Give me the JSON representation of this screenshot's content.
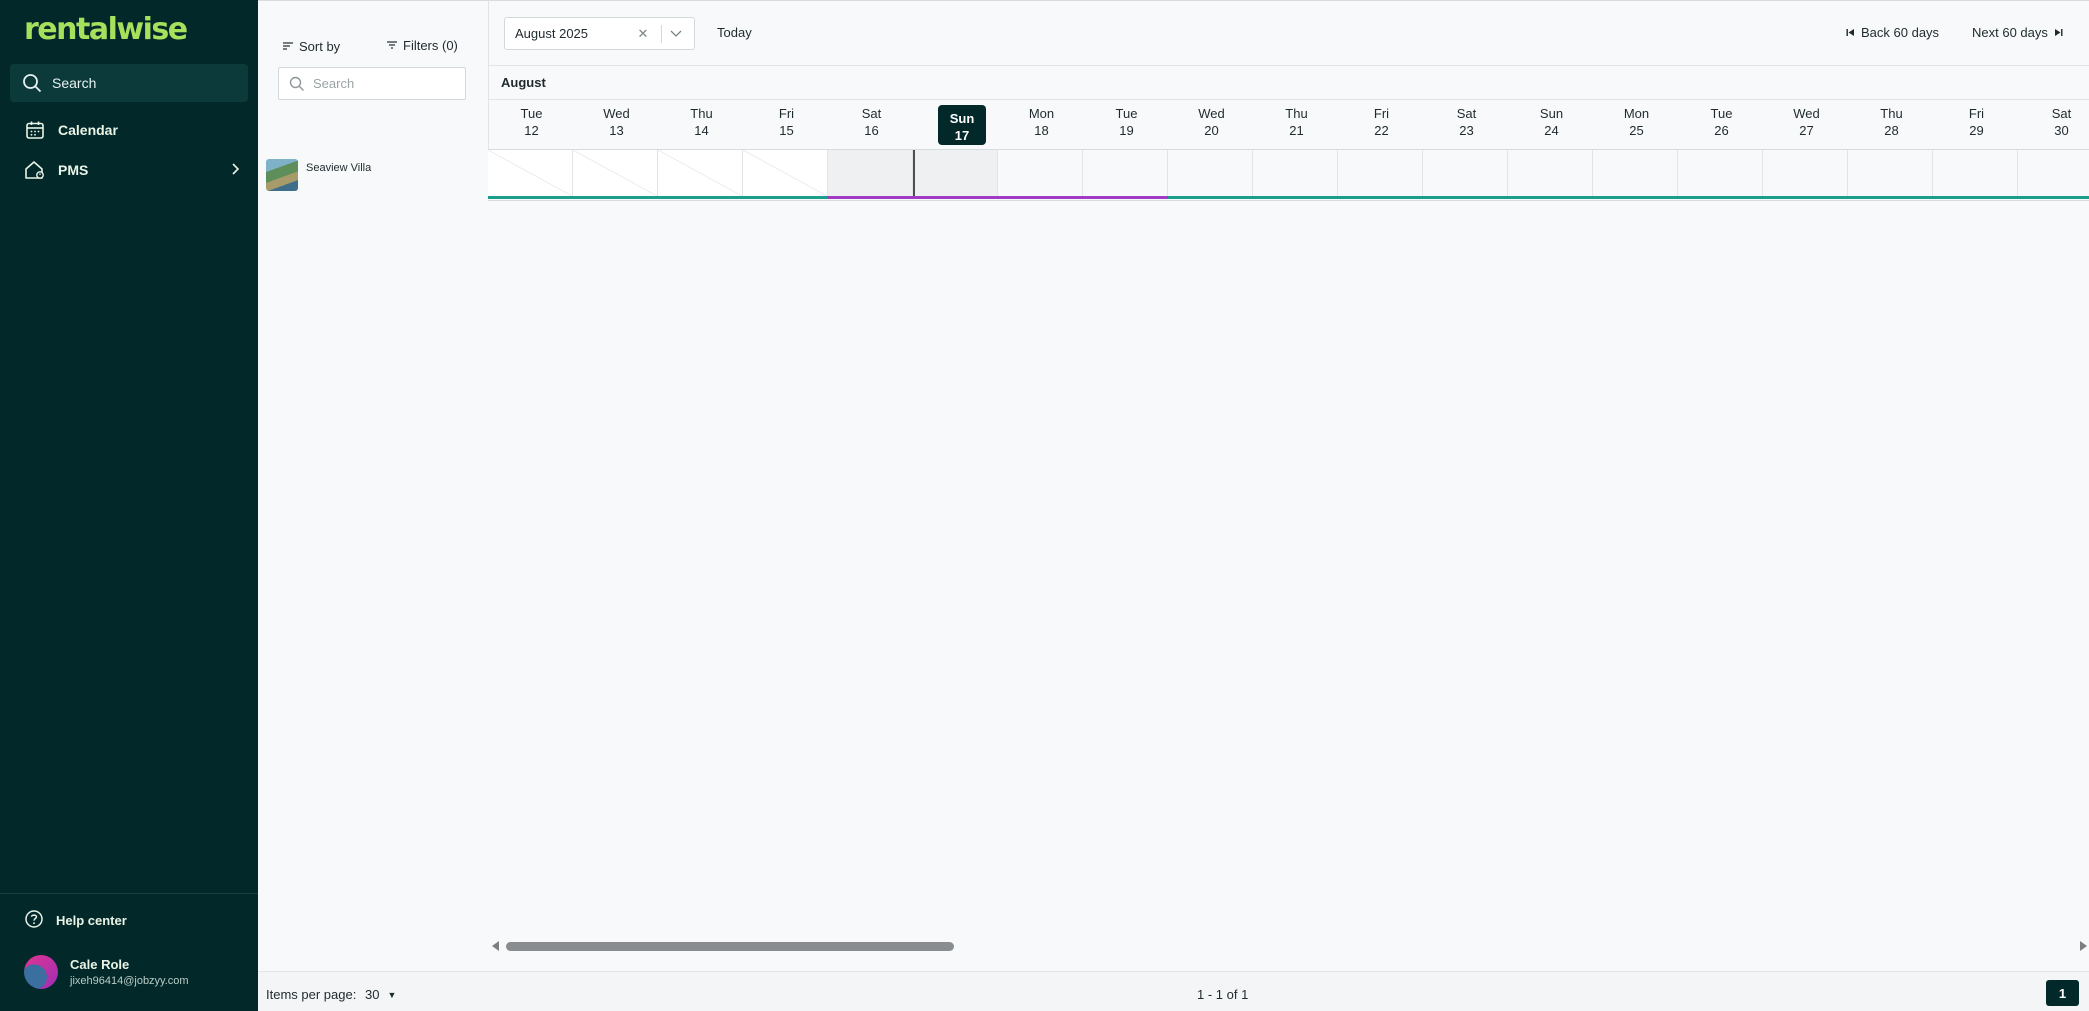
{
  "app": {
    "brand": "rentalwise"
  },
  "sidebar": {
    "search_label": "Search",
    "items": [
      {
        "label": "Calendar",
        "icon": "calendar-icon"
      },
      {
        "label": "PMS",
        "icon": "home-icon"
      }
    ],
    "help_label": "Help center",
    "user": {
      "name": "Cale Role",
      "email": "jixeh96414@jobzyy.com"
    }
  },
  "filters": {
    "sort_label": "Sort by",
    "filters_label": "Filters (0)",
    "search_placeholder": "Search"
  },
  "toolbar": {
    "month_value": "August 2025",
    "today_label": "Today",
    "back_label": "Back 60 days",
    "next_label": "Next 60 days"
  },
  "calendar": {
    "month": "August",
    "today_index": 5,
    "days": [
      {
        "name": "Tue",
        "date": "12"
      },
      {
        "name": "Wed",
        "date": "13"
      },
      {
        "name": "Thu",
        "date": "14"
      },
      {
        "name": "Fri",
        "date": "15"
      },
      {
        "name": "Sat",
        "date": "16"
      },
      {
        "name": "Sun",
        "date": "17"
      },
      {
        "name": "Mon",
        "date": "18"
      },
      {
        "name": "Tue",
        "date": "19"
      },
      {
        "name": "Wed",
        "date": "20"
      },
      {
        "name": "Thu",
        "date": "21"
      },
      {
        "name": "Fri",
        "date": "22"
      },
      {
        "name": "Sat",
        "date": "23"
      },
      {
        "name": "Sun",
        "date": "24"
      },
      {
        "name": "Mon",
        "date": "25"
      },
      {
        "name": "Tue",
        "date": "26"
      },
      {
        "name": "Wed",
        "date": "27"
      },
      {
        "name": "Thu",
        "date": "28"
      },
      {
        "name": "Fri",
        "date": "29"
      },
      {
        "name": "Sat",
        "date": "30"
      }
    ],
    "properties": [
      {
        "name": "Seaview Villa"
      }
    ],
    "colors": {
      "available_bar": "#1b9e8b",
      "booking_bar": "#a23bc4",
      "today_bg": "#03282a"
    }
  },
  "footer": {
    "items_per_page_label": "Items per page:",
    "items_per_page_value": "30",
    "range": "1 - 1 of 1",
    "current_page": "1"
  }
}
